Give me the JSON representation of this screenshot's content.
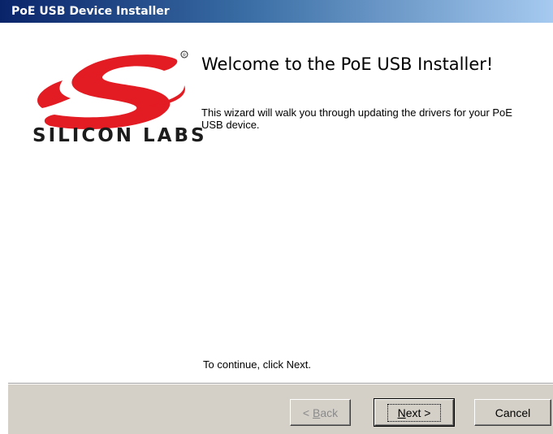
{
  "window": {
    "title": "PoE USB Device Installer"
  },
  "brand": {
    "logo_text": "SILICON LABS",
    "logo_color": "#e31b23"
  },
  "welcome": {
    "heading": "Welcome to the PoE USB Installer!",
    "body": "This wizard will walk you through updating the drivers for your PoE USB device.",
    "continue": "To continue, click Next."
  },
  "buttons": {
    "back_prefix": "< ",
    "back_mnemonic": "B",
    "back_rest": "ack",
    "next_mnemonic": "N",
    "next_rest": "ext >",
    "cancel": "Cancel"
  },
  "colors": {
    "titlebar_start": "#0a246a",
    "titlebar_end": "#a6caf0",
    "footer_bg": "#d4d0c8"
  }
}
